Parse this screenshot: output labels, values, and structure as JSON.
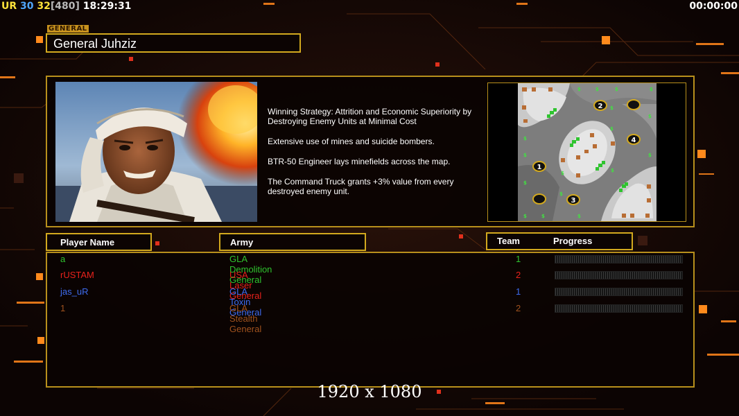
{
  "hud": {
    "ur_label": "UR",
    "num_a": "30",
    "num_b": "32",
    "bracket": "[480]",
    "clock": "18:29:31",
    "game_timer": "00:00:00"
  },
  "general": {
    "tag": "GENERAL",
    "name": "General Juhziz",
    "description": [
      "Winning Strategy: Attrition and Economic Superiority by\n Destroying Enemy Units at Minimal Cost",
      "Extensive use of mines and suicide bombers.",
      "BTR-50 Engineer lays minefields across the map.",
      "The Command Truck grants +3% value from every\n destroyed enemy unit."
    ],
    "portrait_icon": "general-portrait-explosion"
  },
  "minimap": {
    "start_positions": [
      "1",
      "2",
      "3",
      "4"
    ]
  },
  "columns": {
    "player_name": "Player Name",
    "army": "Army",
    "team": "Team",
    "progress": "Progress"
  },
  "players": [
    {
      "name": "a",
      "army": "GLA Demolition General",
      "team": "1",
      "color": "#2fc42f",
      "progress": 0
    },
    {
      "name": "rUSTAM",
      "army": "USA Laser General",
      "team": "2",
      "color": "#e8221c",
      "progress": 0
    },
    {
      "name": "jas_uR",
      "army": "GLA Toxin General",
      "team": "1",
      "color": "#3e6cf0",
      "progress": 0
    },
    {
      "name": "1",
      "army": "GLA Stealth General",
      "team": "2",
      "color": "#a0521e",
      "progress": 0
    }
  ],
  "resolution_overlay": "1920 x 1080",
  "colors": {
    "accent_gold": "#d3a91e",
    "background": "#140806",
    "hud_orange": "#ff7a1a"
  }
}
